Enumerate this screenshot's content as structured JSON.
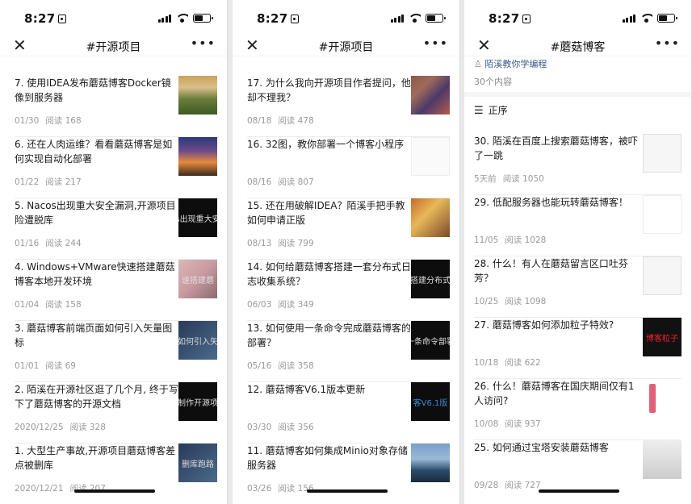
{
  "status": {
    "time": "8:27"
  },
  "screen1": {
    "title": "#开源项目",
    "items": [
      {
        "title": "7. 使用IDEA发布蘑菇博客Docker镜像到服务器",
        "date": "01/30",
        "reads": "阅读 168",
        "thumb": ""
      },
      {
        "title": "6. 还在人肉运维？看看蘑菇博客是如何实现自动化部署",
        "date": "01/22",
        "reads": "阅读 217",
        "thumb": ""
      },
      {
        "title": "5. Nacos出现重大安全漏洞,开源项目险遭脱库",
        "date": "01/16",
        "reads": "阅读 244",
        "thumb": "s出现重大安"
      },
      {
        "title": "4. Windows+VMware快速搭建蘑菇博客本地开发环境",
        "date": "01/04",
        "reads": "阅读 158",
        "thumb": "速搭建蘑"
      },
      {
        "title": "3. 蘑菇博客前端页面如何引入矢量图标",
        "date": "01/01",
        "reads": "阅读 69",
        "thumb": "如何引入矢"
      },
      {
        "title": "2. 陌溪在开源社区逛了几个月, 终于写下了蘑菇博客的开源文档",
        "date": "2020/12/25",
        "reads": "阅读 328",
        "thumb": "制作开源项"
      },
      {
        "title": "1. 大型生产事故,开源项目蘑菇博客差点被删库",
        "date": "2020/12/21",
        "reads": "阅读 207",
        "thumb": "删库跑路"
      }
    ]
  },
  "screen2": {
    "title": "#开源项目",
    "items": [
      {
        "title": "17. 为什么我向开源项目作者提问，他却不理我？",
        "date": "08/18",
        "reads": "阅读 478",
        "thumb": ""
      },
      {
        "title": "16. 32图，教你部署一个博客小程序",
        "date": "08/16",
        "reads": "阅读 807",
        "thumb": ""
      },
      {
        "title": "15. 还在用破解IDEA？陌溪手把手教如何申请正版",
        "date": "08/13",
        "reads": "阅读 799",
        "thumb": ""
      },
      {
        "title": "14. 如何给蘑菇博客搭建一套分布式日志收集系统？",
        "date": "06/03",
        "reads": "阅读 349",
        "thumb": "搭建分布式"
      },
      {
        "title": "13. 如何使用一条命令完成蘑菇博客的部署？",
        "date": "05/16",
        "reads": "阅读 358",
        "thumb": "一条命令部署"
      },
      {
        "title": "12. 蘑菇博客V6.1版本更新",
        "date": "03/30",
        "reads": "阅读 356",
        "thumb": "客V6.1版"
      },
      {
        "title": "11. 蘑菇博客如何集成Minio对象存储服务器",
        "date": "03/26",
        "reads": "阅读 156",
        "thumb": ""
      }
    ]
  },
  "screen3": {
    "title": "#蘑菇博客",
    "author": "陌溪教你学编程",
    "count": "30个内容",
    "order_label": "正序",
    "items": [
      {
        "title": "30. 陌溪在百度上搜索蘑菇博客，被吓了一跳",
        "date": "5天前",
        "reads": "阅读 1050",
        "thumb": ""
      },
      {
        "title": "29. 低配服务器也能玩转蘑菇博客！",
        "date": "11/05",
        "reads": "阅读 1028",
        "thumb": ""
      },
      {
        "title": "28. 什么！有人在蘑菇留言区口吐芬芳？",
        "date": "10/25",
        "reads": "阅读 1098",
        "thumb": ""
      },
      {
        "title": "27. 蘑菇博客如何添加粒子特效?",
        "date": "10/18",
        "reads": "阅读 622",
        "thumb": "博客粒子"
      },
      {
        "title": "26. 什么！蘑菇博客在国庆期间仅有1人访问?",
        "date": "10/08",
        "reads": "阅读 937",
        "thumb": ""
      },
      {
        "title": "25. 如何通过宝塔安装蘑菇博客",
        "date": "09/28",
        "reads": "阅读 727",
        "thumb": ""
      }
    ]
  },
  "icons": {
    "close": "close-icon",
    "more": "more-icon",
    "order": "sort-order-icon",
    "author": "author-icon"
  }
}
